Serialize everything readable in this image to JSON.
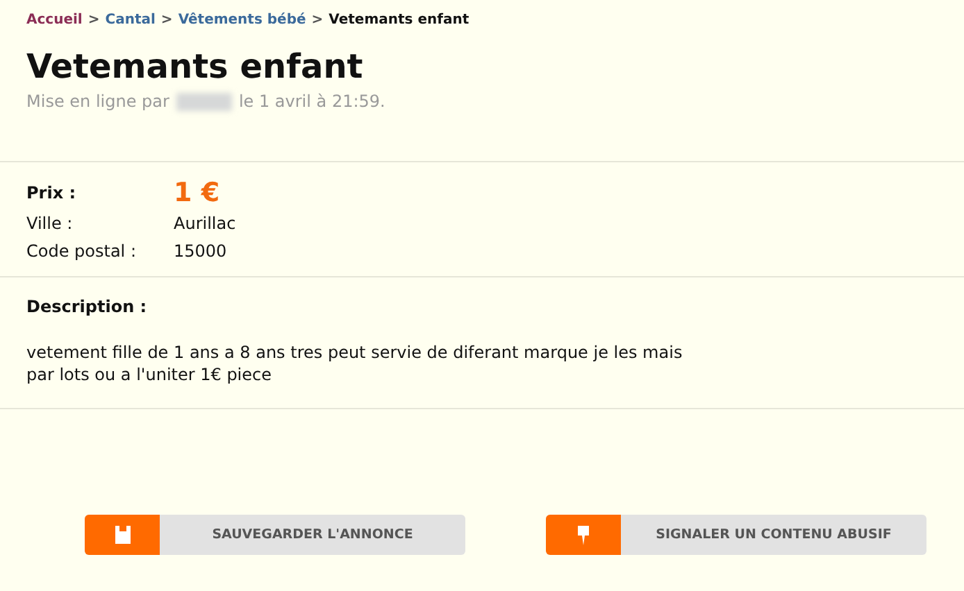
{
  "breadcrumb": [
    {
      "kind": "link",
      "label": "Accueil",
      "color": "#8b2d55"
    },
    {
      "kind": "separator",
      "label": ">"
    },
    {
      "kind": "link",
      "label": "Cantal",
      "color": "#3b6a9b"
    },
    {
      "kind": "separator",
      "label": ">"
    },
    {
      "kind": "link",
      "label": "Vêtements bébé",
      "color": "#3b6a9b"
    },
    {
      "kind": "separator",
      "label": ">"
    },
    {
      "kind": "current",
      "label": "Vetemants enfant"
    }
  ],
  "title": "Vetemants enfant",
  "posted": {
    "prefix": "Mise en ligne par",
    "author_hidden": true,
    "suffix": "le 1 avril à 21:59."
  },
  "details": [
    {
      "kind": "price",
      "label": "Prix :",
      "value": "1 €"
    },
    {
      "kind": "plain",
      "label": "Ville :",
      "value": "Aurillac"
    },
    {
      "kind": "plain",
      "label": "Code postal :",
      "value": "15000"
    }
  ],
  "description": {
    "heading": "Description :",
    "text": "vetement fille de 1 ans a 8 ans tres peut servie de diferant marque je les mais par lots ou a l'uniter 1€ piece"
  },
  "buttons": [
    {
      "kind": "save",
      "label": "SAUVEGARDER L'ANNONCE"
    },
    {
      "kind": "flag",
      "label": "SIGNALER UN CONTENU ABUSIF"
    }
  ]
}
